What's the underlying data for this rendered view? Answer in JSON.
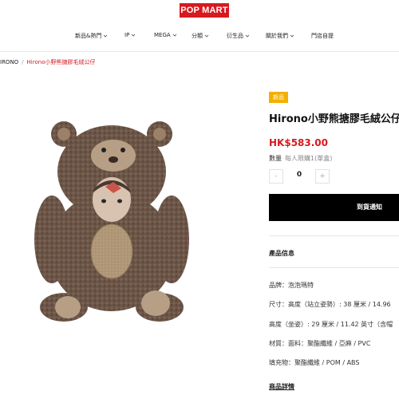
{
  "header": {
    "logo": "POP MART",
    "nav": [
      {
        "label": "新品&熱門",
        "dropdown": true
      },
      {
        "label": "IP",
        "dropdown": true
      },
      {
        "label": "MEGA",
        "dropdown": true
      },
      {
        "label": "分類",
        "dropdown": true
      },
      {
        "label": "衍生品",
        "dropdown": true
      },
      {
        "label": "關於我們",
        "dropdown": true
      },
      {
        "label": "門店自提",
        "dropdown": false
      }
    ]
  },
  "breadcrumb": {
    "parent": "IRONO",
    "current": "Hirono小野熊搪膠毛絨公仔"
  },
  "product": {
    "badge": "新品",
    "title": "Hirono小野熊搪膠毛絨公仔",
    "price": "HK$583.00",
    "qty_label": "數量",
    "qty_limit": "每人限購1(單盒)",
    "qty_minus": "-",
    "qty_value": "0",
    "qty_plus": "+",
    "notify_button": "到貨通知",
    "info_title": "產品信息",
    "info_lines": [
      "品牌：泡泡瑪特",
      "尺寸：高度（站立姿勢）: 38 厘米 / 14.96",
      "高度（坐姿）: 29 厘米 / 11.42 英寸（含帽",
      "材質：面料：聚酯纖維 / 亞麻 / PVC",
      "填充物：聚酯纖維 / POM / ABS"
    ],
    "details_link": "商品詳情"
  },
  "colors": {
    "brand_red": "#d71a20",
    "badge_yellow": "#f3b000",
    "button_black": "#000000"
  },
  "icons": {
    "nav_dropdown": "chevron-down-icon",
    "product_image": "brown-plush-bear-figure"
  }
}
